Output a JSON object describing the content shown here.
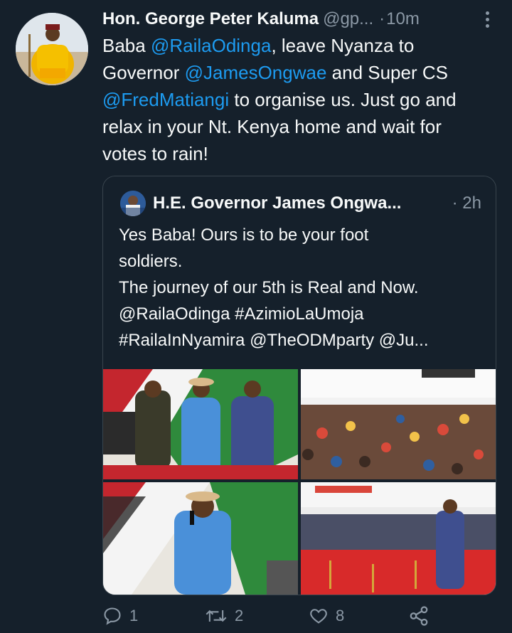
{
  "tweet": {
    "author_name": "Hon. George Peter Kaluma",
    "author_handle": "@gp...",
    "separator": "·",
    "time": "10m",
    "lines": [
      [
        {
          "t": "Baba "
        },
        {
          "t": "@RailaOdinga",
          "m": true
        },
        {
          "t": ", leave Nyanza to"
        }
      ],
      [
        {
          "t": "Governor "
        },
        {
          "t": "@JamesOngwae",
          "m": true
        },
        {
          "t": " and Super CS"
        }
      ],
      [
        {
          "t": "@FredMatiangi",
          "m": true
        },
        {
          "t": " to organise us. Just go and"
        }
      ],
      [
        {
          "t": "relax in your Nt. Kenya home and wait for"
        }
      ],
      [
        {
          "t": "votes to rain!"
        }
      ]
    ]
  },
  "quoted": {
    "author_name": "H.E. Governor James Ongwa...",
    "time": "· 2h",
    "lines": [
      "Yes Baba! Ours is to be your foot",
      "soldiers.",
      "The journey of our 5th is Real and Now.",
      "@RailaOdinga #AzimioLaUmoja",
      "#RailaInNyamira @TheODMparty @Ju..."
    ]
  },
  "actions": {
    "replies": "1",
    "retweets": "2",
    "likes": "8"
  },
  "icons": [
    "more-icon",
    "reply-icon",
    "retweet-icon",
    "like-icon",
    "share-icon"
  ],
  "colors": {
    "background": "#15202b",
    "text": "#f7f9f9",
    "secondary": "#8b98a5",
    "link": "#1d9bf0",
    "border": "#38444d"
  }
}
